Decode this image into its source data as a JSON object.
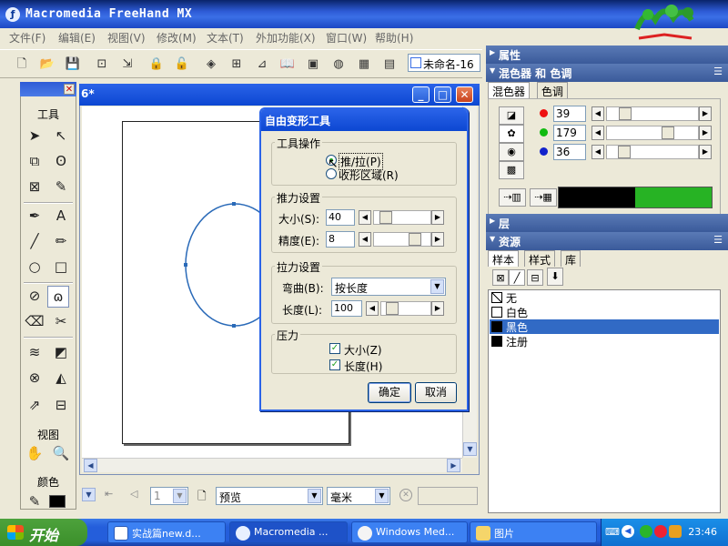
{
  "app": {
    "title": "Macromedia FreeHand MX"
  },
  "menus": [
    "文件(F)",
    "编辑(E)",
    "视图(V)",
    "修改(M)",
    "文本(T)",
    "外加功能(X)",
    "窗口(W)",
    "帮助(H)"
  ],
  "toolbar": {
    "doc_name": "未命名-16"
  },
  "document": {
    "title": "6*"
  },
  "tools": {
    "title": "工具",
    "view_label": "视图",
    "color_label": "颜色"
  },
  "status": {
    "view_mode": "预览",
    "units": "毫米",
    "page": "1"
  },
  "dialog": {
    "title": "自由变形工具",
    "tool_op": {
      "group": "工具操作",
      "opt1": "推/拉(P)",
      "opt2": "收形区域(R)"
    },
    "push": {
      "group": "推力设置",
      "size_label": "大小(S):",
      "size_value": "40",
      "prec_label": "精度(E):",
      "prec_value": "8"
    },
    "pull": {
      "group": "拉力设置",
      "bend_label": "弯曲(B):",
      "bend_value": "按长度",
      "length_label": "长度(L):",
      "length_value": "100"
    },
    "pressure": {
      "group": "压力",
      "size": "大小(Z)",
      "length": "长度(H)"
    },
    "ok": "确定",
    "cancel": "取消"
  },
  "panels": {
    "properties": "属性",
    "mixer_title": "混色器 和 色调",
    "tab_mixer": "混色器",
    "tab_tint": "色调",
    "rgb": {
      "r": "39",
      "g": "179",
      "b": "36"
    },
    "layers": "层",
    "assets": "资源",
    "tab_swatches": "样本",
    "tab_styles": "样式",
    "tab_library": "库",
    "swatches": [
      {
        "name": "无",
        "color": "#ffffff"
      },
      {
        "name": "白色",
        "color": "#ffffff"
      },
      {
        "name": "黑色",
        "color": "#000000"
      },
      {
        "name": "注册",
        "color": "#000000"
      }
    ]
  },
  "taskbar": {
    "start": "开始",
    "tasks": [
      "实战篇new.d...",
      "Macromedia ...",
      "Windows Med...",
      "图片"
    ],
    "clock": "23:46"
  },
  "colors": {
    "accent": "#2a63e8",
    "mix_color": "#27b324",
    "selection": "#316ac5"
  }
}
